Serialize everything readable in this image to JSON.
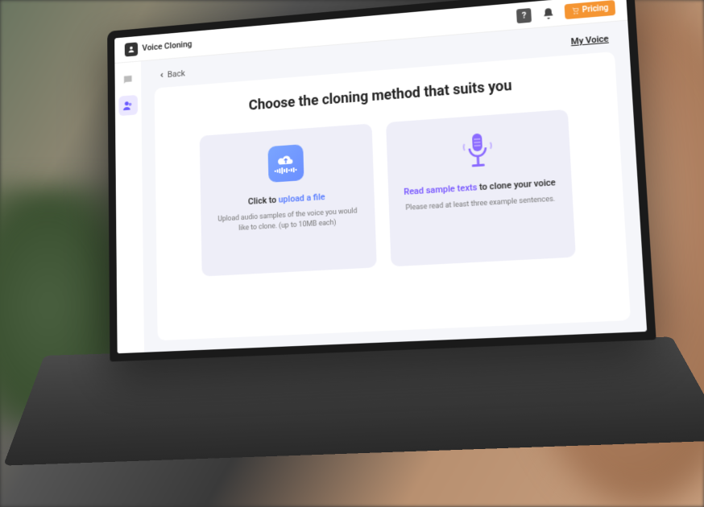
{
  "header": {
    "app_title": "Voice Cloning",
    "pricing_label": "Pricing"
  },
  "subheader": {
    "back_label": "Back",
    "myvoice_label": "My Voice"
  },
  "main": {
    "heading": "Choose the cloning method that suits you",
    "upload_card": {
      "title_prefix": "Click to ",
      "title_accent": "upload a file",
      "description": "Upload audio samples of the voice you would like to clone. (up to 10MB each)"
    },
    "record_card": {
      "title_accent": "Read sample texts",
      "title_suffix": " to clone your voice",
      "description": "Please read at least three example sentences."
    }
  }
}
